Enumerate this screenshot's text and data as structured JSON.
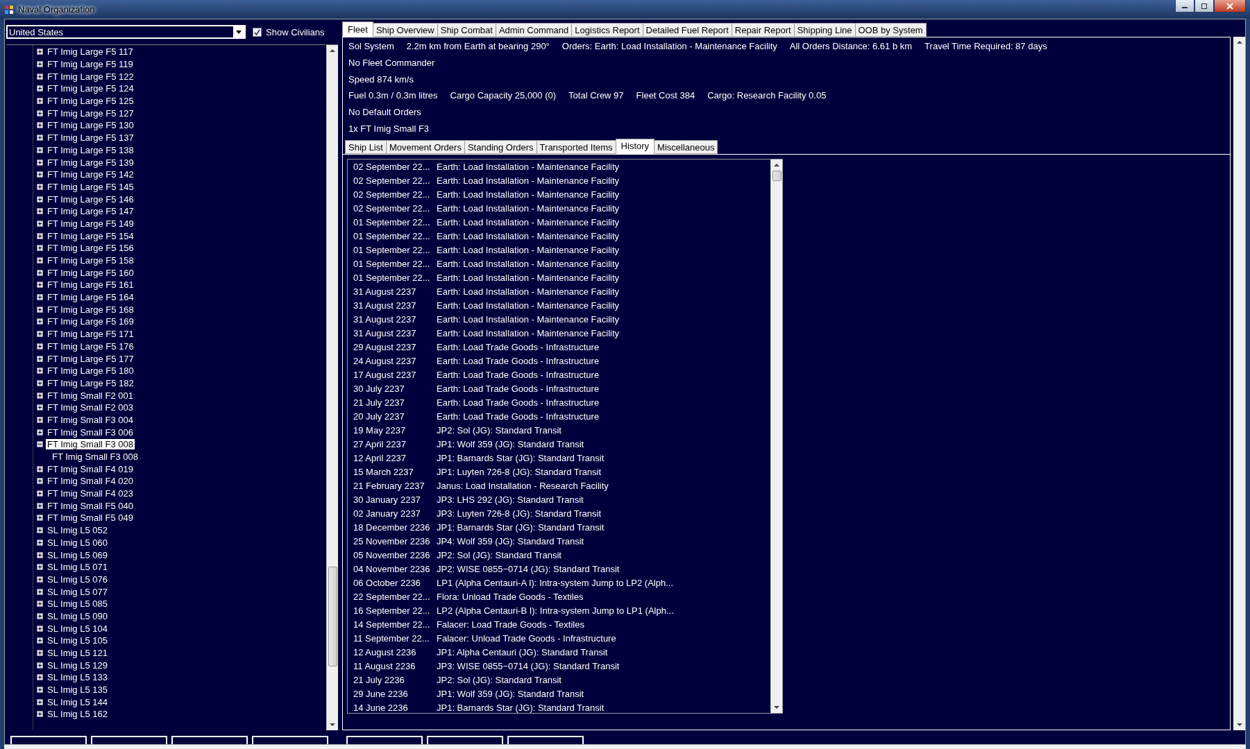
{
  "window": {
    "title": "Naval Organization"
  },
  "race_select": {
    "value": "United States"
  },
  "show_civilians": {
    "label": "Show Civilians",
    "checked": true
  },
  "tree": [
    {
      "label": "FT Imig Large F5 117",
      "expanded": false,
      "selected": false
    },
    {
      "label": "FT Imig Large F5 119",
      "expanded": false,
      "selected": false
    },
    {
      "label": "FT Imig Large F5 122",
      "expanded": false,
      "selected": false
    },
    {
      "label": "FT Imig Large F5 124",
      "expanded": false,
      "selected": false
    },
    {
      "label": "FT Imig Large F5 125",
      "expanded": false,
      "selected": false
    },
    {
      "label": "FT Imig Large F5 127",
      "expanded": false,
      "selected": false
    },
    {
      "label": "FT Imig Large F5 130",
      "expanded": false,
      "selected": false
    },
    {
      "label": "FT Imig Large F5 137",
      "expanded": false,
      "selected": false
    },
    {
      "label": "FT Imig Large F5 138",
      "expanded": false,
      "selected": false
    },
    {
      "label": "FT Imig Large F5 139",
      "expanded": false,
      "selected": false
    },
    {
      "label": "FT Imig Large F5 142",
      "expanded": false,
      "selected": false
    },
    {
      "label": "FT Imig Large F5 145",
      "expanded": false,
      "selected": false
    },
    {
      "label": "FT Imig Large F5 146",
      "expanded": false,
      "selected": false
    },
    {
      "label": "FT Imig Large F5 147",
      "expanded": false,
      "selected": false
    },
    {
      "label": "FT Imig Large F5 149",
      "expanded": false,
      "selected": false
    },
    {
      "label": "FT Imig Large F5 154",
      "expanded": false,
      "selected": false
    },
    {
      "label": "FT Imig Large F5 156",
      "expanded": false,
      "selected": false
    },
    {
      "label": "FT Imig Large F5 158",
      "expanded": false,
      "selected": false
    },
    {
      "label": "FT Imig Large F5 160",
      "expanded": false,
      "selected": false
    },
    {
      "label": "FT Imig Large F5 161",
      "expanded": false,
      "selected": false
    },
    {
      "label": "FT Imig Large F5 164",
      "expanded": false,
      "selected": false
    },
    {
      "label": "FT Imig Large F5 168",
      "expanded": false,
      "selected": false
    },
    {
      "label": "FT Imig Large F5 169",
      "expanded": false,
      "selected": false
    },
    {
      "label": "FT Imig Large F5 171",
      "expanded": false,
      "selected": false
    },
    {
      "label": "FT Imig Large F5 176",
      "expanded": false,
      "selected": false
    },
    {
      "label": "FT Imig Large F5 177",
      "expanded": false,
      "selected": false
    },
    {
      "label": "FT Imig Large F5 180",
      "expanded": false,
      "selected": false
    },
    {
      "label": "FT Imig Large F5 182",
      "expanded": false,
      "selected": false
    },
    {
      "label": "FT Imig Small F2 001",
      "expanded": false,
      "selected": false
    },
    {
      "label": "FT Imig Small F2 003",
      "expanded": false,
      "selected": false
    },
    {
      "label": "FT Imig Small F3 004",
      "expanded": false,
      "selected": false
    },
    {
      "label": "FT Imig Small F3 006",
      "expanded": false,
      "selected": false
    },
    {
      "label": "FT Imig Small F3 008",
      "expanded": true,
      "selected": true,
      "children": [
        {
          "label": "FT Imig Small F3 008",
          "selected": false
        }
      ]
    },
    {
      "label": "FT Imig Small F4 019",
      "expanded": false,
      "selected": false
    },
    {
      "label": "FT Imig Small F4 020",
      "expanded": false,
      "selected": false
    },
    {
      "label": "FT Imig Small F4 023",
      "expanded": false,
      "selected": false
    },
    {
      "label": "FT Imig Small F5 040",
      "expanded": false,
      "selected": false
    },
    {
      "label": "FT Imig Small F5 049",
      "expanded": false,
      "selected": false
    },
    {
      "label": "SL Imig L5 052",
      "expanded": false,
      "selected": false
    },
    {
      "label": "SL Imig L5 060",
      "expanded": false,
      "selected": false
    },
    {
      "label": "SL Imig L5 069",
      "expanded": false,
      "selected": false
    },
    {
      "label": "SL Imig L5 071",
      "expanded": false,
      "selected": false
    },
    {
      "label": "SL Imig L5 076",
      "expanded": false,
      "selected": false
    },
    {
      "label": "SL Imig L5 077",
      "expanded": false,
      "selected": false
    },
    {
      "label": "SL Imig L5 085",
      "expanded": false,
      "selected": false
    },
    {
      "label": "SL Imig L5 090",
      "expanded": false,
      "selected": false
    },
    {
      "label": "SL Imig L5 104",
      "expanded": false,
      "selected": false
    },
    {
      "label": "SL Imig L5 105",
      "expanded": false,
      "selected": false
    },
    {
      "label": "SL Imig L5 121",
      "expanded": false,
      "selected": false
    },
    {
      "label": "SL Imig L5 129",
      "expanded": false,
      "selected": false
    },
    {
      "label": "SL Imig L5 133",
      "expanded": false,
      "selected": false
    },
    {
      "label": "SL Imig L5 135",
      "expanded": false,
      "selected": false
    },
    {
      "label": "SL Imig L5 144",
      "expanded": false,
      "selected": false
    },
    {
      "label": "SL Imig L5 162",
      "expanded": false,
      "selected": false
    }
  ],
  "tabs": [
    {
      "label": "Fleet",
      "selected": true
    },
    {
      "label": "Ship Overview",
      "selected": false
    },
    {
      "label": "Ship Combat",
      "selected": false
    },
    {
      "label": "Admin Command",
      "selected": false
    },
    {
      "label": "Logistics Report",
      "selected": false
    },
    {
      "label": "Detailed Fuel Report",
      "selected": false
    },
    {
      "label": "Repair Report",
      "selected": false
    },
    {
      "label": "Shipping Line",
      "selected": false
    },
    {
      "label": "OOB by System",
      "selected": false
    }
  ],
  "fleet_info": [
    [
      "Sol System",
      "2.2m km from Earth at bearing 290°",
      "Orders: Earth: Load Installation - Maintenance Facility",
      "All Orders Distance: 6.61 b km",
      "Travel Time Required: 87 days"
    ],
    [
      "No Fleet Commander"
    ],
    [
      "Speed 874 km/s"
    ],
    [
      "Fuel 0.3m / 0.3m litres",
      "Cargo Capacity 25,000 (0)",
      "Total Crew 97",
      "Fleet Cost 384",
      "Cargo: Research Facility 0.05"
    ],
    [
      "No Default Orders"
    ],
    [
      "1x FT Imig Small F3"
    ]
  ],
  "sub_tabs": [
    {
      "label": "Ship List",
      "selected": false
    },
    {
      "label": "Movement Orders",
      "selected": false
    },
    {
      "label": "Standing Orders",
      "selected": false
    },
    {
      "label": "Transported Items",
      "selected": false
    },
    {
      "label": "History",
      "selected": true
    },
    {
      "label": "Miscellaneous",
      "selected": false
    }
  ],
  "history": [
    {
      "date": "02 September 22...",
      "event": "Earth: Load Installation - Maintenance Facility"
    },
    {
      "date": "02 September 22...",
      "event": "Earth: Load Installation - Maintenance Facility"
    },
    {
      "date": "02 September 22...",
      "event": "Earth: Load Installation - Maintenance Facility"
    },
    {
      "date": "02 September 22...",
      "event": "Earth: Load Installation - Maintenance Facility"
    },
    {
      "date": "01 September 22...",
      "event": "Earth: Load Installation - Maintenance Facility"
    },
    {
      "date": "01 September 22...",
      "event": "Earth: Load Installation - Maintenance Facility"
    },
    {
      "date": "01 September 22...",
      "event": "Earth: Load Installation - Maintenance Facility"
    },
    {
      "date": "01 September 22...",
      "event": "Earth: Load Installation - Maintenance Facility"
    },
    {
      "date": "01 September 22...",
      "event": "Earth: Load Installation - Maintenance Facility"
    },
    {
      "date": "31 August 2237",
      "event": "Earth: Load Installation - Maintenance Facility"
    },
    {
      "date": "31 August 2237",
      "event": "Earth: Load Installation - Maintenance Facility"
    },
    {
      "date": "31 August 2237",
      "event": "Earth: Load Installation - Maintenance Facility"
    },
    {
      "date": "31 August 2237",
      "event": "Earth: Load Installation - Maintenance Facility"
    },
    {
      "date": "29 August 2237",
      "event": "Earth: Load Trade Goods - Infrastructure"
    },
    {
      "date": "24 August 2237",
      "event": "Earth: Load Trade Goods - Infrastructure"
    },
    {
      "date": "17 August 2237",
      "event": "Earth: Load Trade Goods - Infrastructure"
    },
    {
      "date": "30 July 2237",
      "event": "Earth: Load Trade Goods - Infrastructure"
    },
    {
      "date": "21 July 2237",
      "event": "Earth: Load Trade Goods - Infrastructure"
    },
    {
      "date": "20 July 2237",
      "event": "Earth: Load Trade Goods - Infrastructure"
    },
    {
      "date": "19 May 2237",
      "event": "JP2: Sol (JG): Standard Transit"
    },
    {
      "date": "27 April 2237",
      "event": "JP1: Wolf 359 (JG): Standard Transit"
    },
    {
      "date": "12 April 2237",
      "event": "JP1: Barnards Star (JG): Standard Transit"
    },
    {
      "date": "15 March 2237",
      "event": "JP1: Luyten 726-8 (JG): Standard Transit"
    },
    {
      "date": "21 February 2237",
      "event": "Janus: Load Installation - Research Facility"
    },
    {
      "date": "30 January 2237",
      "event": "JP3: LHS 292 (JG): Standard Transit"
    },
    {
      "date": "02 January 2237",
      "event": "JP3: Luyten 726-8 (JG): Standard Transit"
    },
    {
      "date": "18 December 2236",
      "event": "JP1: Barnards Star (JG): Standard Transit"
    },
    {
      "date": "25 November 2236",
      "event": "JP4: Wolf 359 (JG): Standard Transit"
    },
    {
      "date": "05 November 2236",
      "event": "JP2: Sol (JG): Standard Transit"
    },
    {
      "date": "04 November 2236",
      "event": "JP2: WISE 0855−0714 (JG): Standard Transit"
    },
    {
      "date": "06 October 2236",
      "event": "LP1  (Alpha Centauri-A I): Intra-system Jump to LP2  (Alph..."
    },
    {
      "date": "22 September 22...",
      "event": "Flora: Unload Trade Goods - Textiles"
    },
    {
      "date": "16 September 22...",
      "event": "LP2  (Alpha Centauri-B I): Intra-system Jump to LP1  (Alph..."
    },
    {
      "date": "14 September 22...",
      "event": "Falacer: Load Trade Goods - Textiles"
    },
    {
      "date": "11 September 22...",
      "event": "Falacer: Unload Trade Goods - Infrastructure"
    },
    {
      "date": "12 August 2236",
      "event": "JP1: Alpha Centauri (JG): Standard Transit"
    },
    {
      "date": "11 August 2236",
      "event": "JP3: WISE 0855−0714 (JG): Standard Transit"
    },
    {
      "date": "21 July 2236",
      "event": "JP2: Sol (JG): Standard Transit"
    },
    {
      "date": "29 June 2236",
      "event": "JP1: Wolf 359 (JG): Standard Transit"
    },
    {
      "date": "14 June 2236",
      "event": "JP1: Barnards Star (JG): Standard Transit"
    }
  ]
}
